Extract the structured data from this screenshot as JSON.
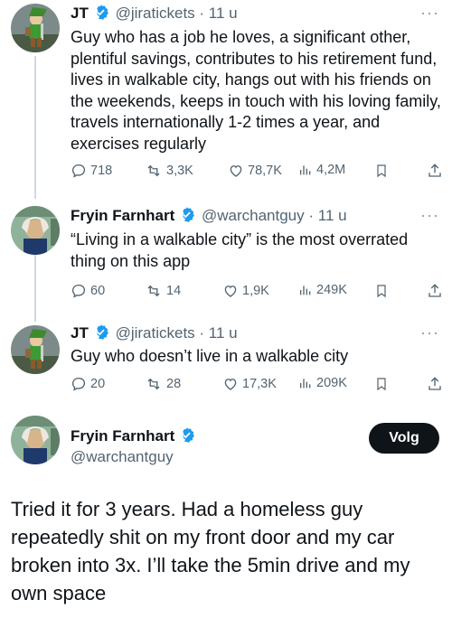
{
  "tweets": [
    {
      "name": "JT",
      "handle": "@jiratickets",
      "meta": "· 11 u",
      "text": "Guy who has a job he loves, a significant other, plentiful savings, contributes to his retirement fund, lives in walkable city, hangs out with his friends on the weekends, keeps in touch with his loving family, travels internationally 1-2 times a year, and exercises regularly",
      "replies": "718",
      "retweets": "3,3K",
      "likes": "78,7K",
      "views": "4,2M"
    },
    {
      "name": "Fryin Farnhart",
      "handle": "@warchantguy",
      "meta": "· 11 u",
      "text": "“Living in a walkable city” is the most overrated thing on this app",
      "replies": "60",
      "retweets": "14",
      "likes": "1,9K",
      "views": "249K"
    },
    {
      "name": "JT",
      "handle": "@jiratickets",
      "meta": "· 11 u",
      "text": "Guy who doesn’t live in a walkable city",
      "replies": "20",
      "retweets": "28",
      "likes": "17,3K",
      "views": "209K"
    }
  ],
  "main": {
    "name": "Fryin Farnhart",
    "handle": "@warchantguy",
    "follow_label": "Volg",
    "text": "Tried it for 3 years. Had a homeless guy repeatedly shit on my front door and my car broken into 3x. I’ll take the 5min drive and my own space"
  },
  "more_glyph": "···",
  "colors": {
    "verified": "#1d9bf0",
    "muted": "#536471",
    "text": "#0f1419",
    "thread": "#cfd9de"
  }
}
